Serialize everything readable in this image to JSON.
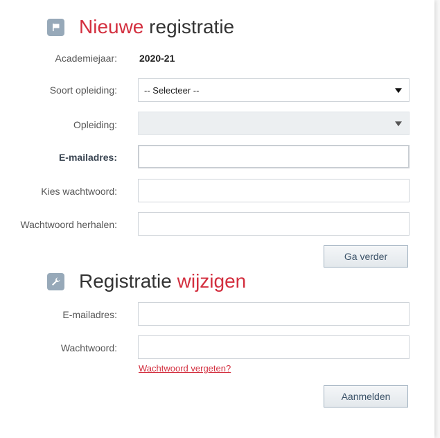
{
  "new_registration": {
    "title_accent": "Nieuwe",
    "title_rest": " registratie",
    "academic_year_label": "Academiejaar:",
    "academic_year_value": "2020-21",
    "study_type_label": "Soort opleiding:",
    "study_type_selected": "-- Selecteer --",
    "program_label": "Opleiding:",
    "program_selected": "",
    "email_label": "E-mailadres:",
    "email_value": "",
    "password_label": "Kies wachtwoord:",
    "password_value": "",
    "password_repeat_label": "Wachtwoord herhalen:",
    "password_repeat_value": "",
    "continue_button": "Ga verder"
  },
  "change_registration": {
    "title_rest": "Registratie ",
    "title_accent": "wijzigen",
    "email_label": "E-mailadres:",
    "email_value": "",
    "password_label": "Wachtwoord:",
    "password_value": "",
    "forgot_link": "Wachtwoord vergeten?",
    "login_button": "Aanmelden"
  },
  "icons": {
    "new_registration": "flag-icon",
    "change_registration": "wrench-icon"
  },
  "colors": {
    "accent": "#d32f3f",
    "icon_bg": "#97a9b9",
    "button_border": "#9fb0bf",
    "button_text": "#3b5268"
  }
}
